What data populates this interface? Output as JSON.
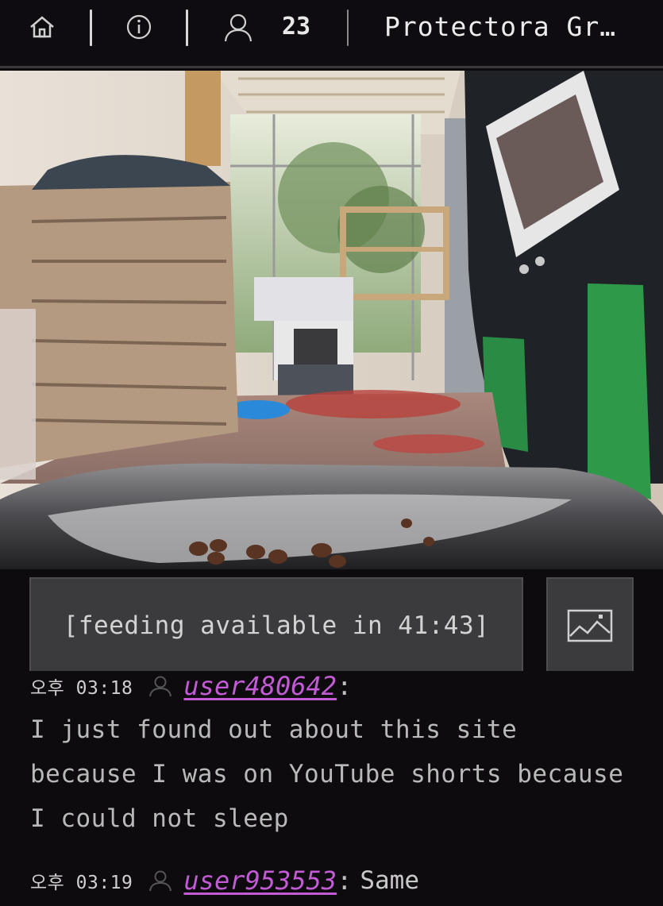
{
  "topbar": {
    "viewer_count": "23",
    "room_title": "Protectora Gr…",
    "home_icon": "home-icon",
    "info_icon": "info-icon",
    "viewers_icon": "user-icon"
  },
  "controls": {
    "feed_label": "[feeding available in 41:43]",
    "snapshot_icon": "image-icon"
  },
  "chat": {
    "messages": [
      {
        "time": "오후 03:18",
        "user": "user480642",
        "text": "I just found out about this site because I was on YouTube shorts because I could not sleep"
      },
      {
        "time": "오후 03:19",
        "user": "user953553",
        "text": "Same"
      }
    ]
  },
  "colors": {
    "background": "#0d0b0e",
    "username": "#c35ad6",
    "button": "#3b3a3d"
  }
}
